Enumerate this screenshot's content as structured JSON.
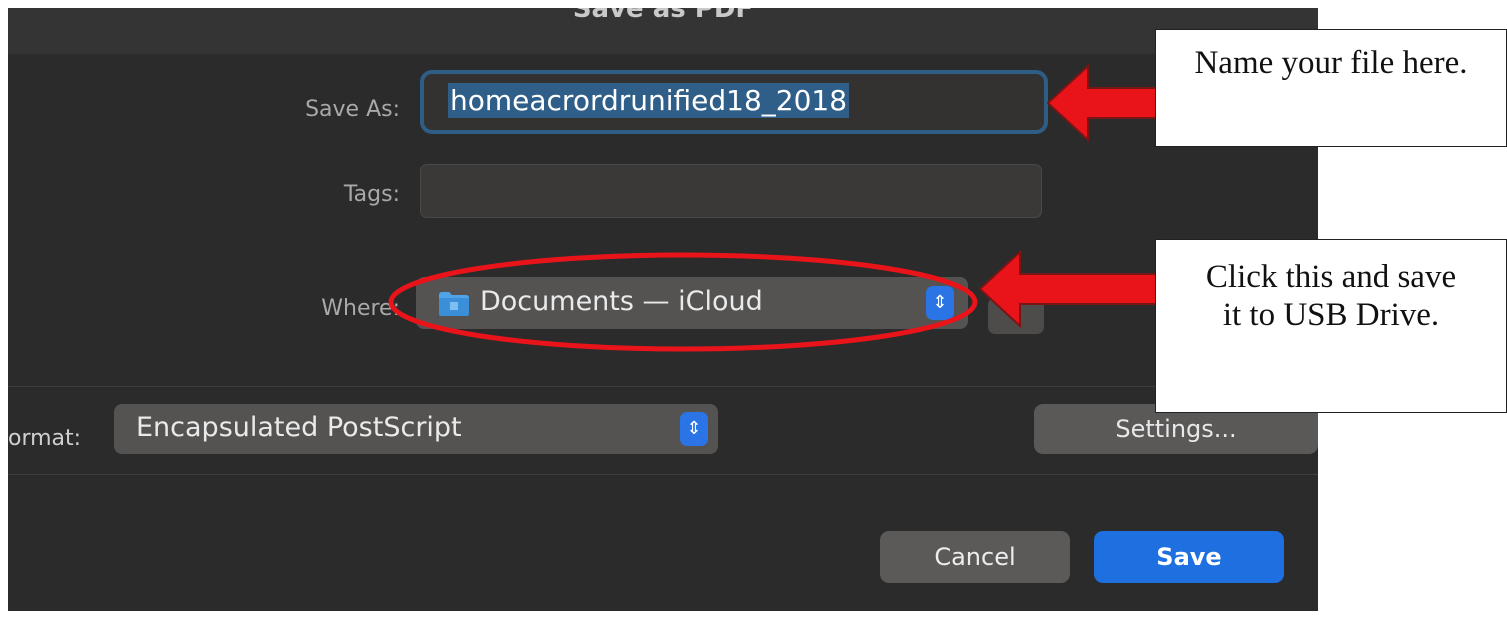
{
  "dialog": {
    "title": "Save as PDF",
    "save_as_label": "Save As:",
    "save_as_value": "homeacrordrunified18_2018",
    "tags_label": "Tags:",
    "where_label": "Where:",
    "where_value": "Documents — iCloud",
    "format_label": "ormat:",
    "format_value": "Encapsulated PostScript",
    "settings_button": "Settings...",
    "cancel_button": "Cancel",
    "save_button": "Save"
  },
  "annotations": {
    "callout_1": "Name your file here.",
    "callout_2": "Click this and save it to USB Drive."
  },
  "colors": {
    "dialog_bg": "#2b2b2b",
    "accent_blue": "#2a74e6",
    "arrow_red": "#e8141a"
  },
  "icons": [
    "folder-icon",
    "updown-chevron-icon"
  ]
}
